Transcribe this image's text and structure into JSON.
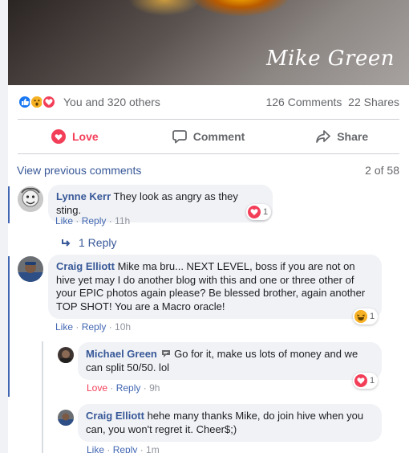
{
  "photo": {
    "watermark": "Mike Green"
  },
  "post_stats": {
    "reactions_text": "You and 320 others",
    "comments_shares": "126 Comments  22 Shares",
    "icons": [
      "like-icon",
      "wow-icon",
      "love-icon"
    ],
    "colors": {
      "like": "#1877f2",
      "wow": "#f7b125",
      "love": "#f33e58"
    }
  },
  "actions": {
    "love": "Love",
    "comment": "Comment",
    "share": "Share"
  },
  "thread": {
    "view_previous": "View previous comments",
    "pager": "2 of 58",
    "comments": [
      {
        "author": "Lynne Kerr",
        "text": "They look as angry as they sting.",
        "like": "Like",
        "reply": "Reply",
        "time": "11h",
        "reaction": {
          "icon": "love-icon",
          "count": "1"
        },
        "replies_link": "1 Reply"
      },
      {
        "author": "Craig Elliott",
        "text": "Mike ma bru... NEXT LEVEL, boss if you are not on hive yet may I do another blog with this and one or three other of your EPIC photos again please? Be blessed brother, again another TOP SHOT! You are a Macro oracle!",
        "like": "Like",
        "reply": "Reply",
        "time": "10h",
        "reaction": {
          "icon": "haha-icon",
          "count": "1"
        }
      }
    ],
    "replies": [
      {
        "author": "Michael Green",
        "text": "Go for it, make us lots of money and we can split 50/50. lol",
        "like": "Love",
        "reply": "Reply",
        "time": "9h",
        "reaction": {
          "icon": "love-icon",
          "count": "1"
        }
      },
      {
        "author": "Craig Elliott",
        "text": "hehe many thanks Mike, do join hive when you can, you won't regret it. Cheer$;)",
        "like": "Like",
        "reply": "Reply",
        "time": "1m"
      }
    ],
    "separator": " · "
  }
}
